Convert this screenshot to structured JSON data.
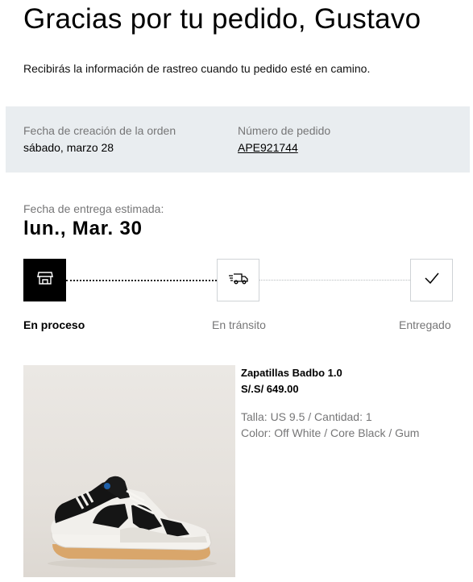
{
  "header": {
    "title": "Gracias por tu pedido, Gustavo",
    "subtitle": "Recibirás la información de rastreo cuando tu pedido esté en camino."
  },
  "order_info": {
    "created_label": "Fecha de creación de la orden",
    "created_value": "sábado, marzo 28",
    "number_label": "Número de pedido",
    "number_value": "APE921744"
  },
  "delivery": {
    "eta_label": "Fecha de entrega estimada:",
    "eta_date": "lun., Mar. 30"
  },
  "tracker": {
    "steps": [
      {
        "label": "En proceso",
        "icon": "store-icon",
        "state": "active"
      },
      {
        "label": "En tránsito",
        "icon": "delivery-truck-icon",
        "state": "pending"
      },
      {
        "label": "Entregado",
        "icon": "checkmark-icon",
        "state": "pending"
      }
    ]
  },
  "product": {
    "image_icon": "sneaker-image",
    "name": "Zapatillas Badbo 1.0",
    "price": "S/.S/ 649.00",
    "size_qty": "Talla: US 9.5 / Cantidad: 1",
    "color": "Color: Off White / Core Black / Gum"
  },
  "colors": {
    "info_background": "#e9edf0",
    "muted_text": "#767677",
    "active_step": "#000000"
  }
}
